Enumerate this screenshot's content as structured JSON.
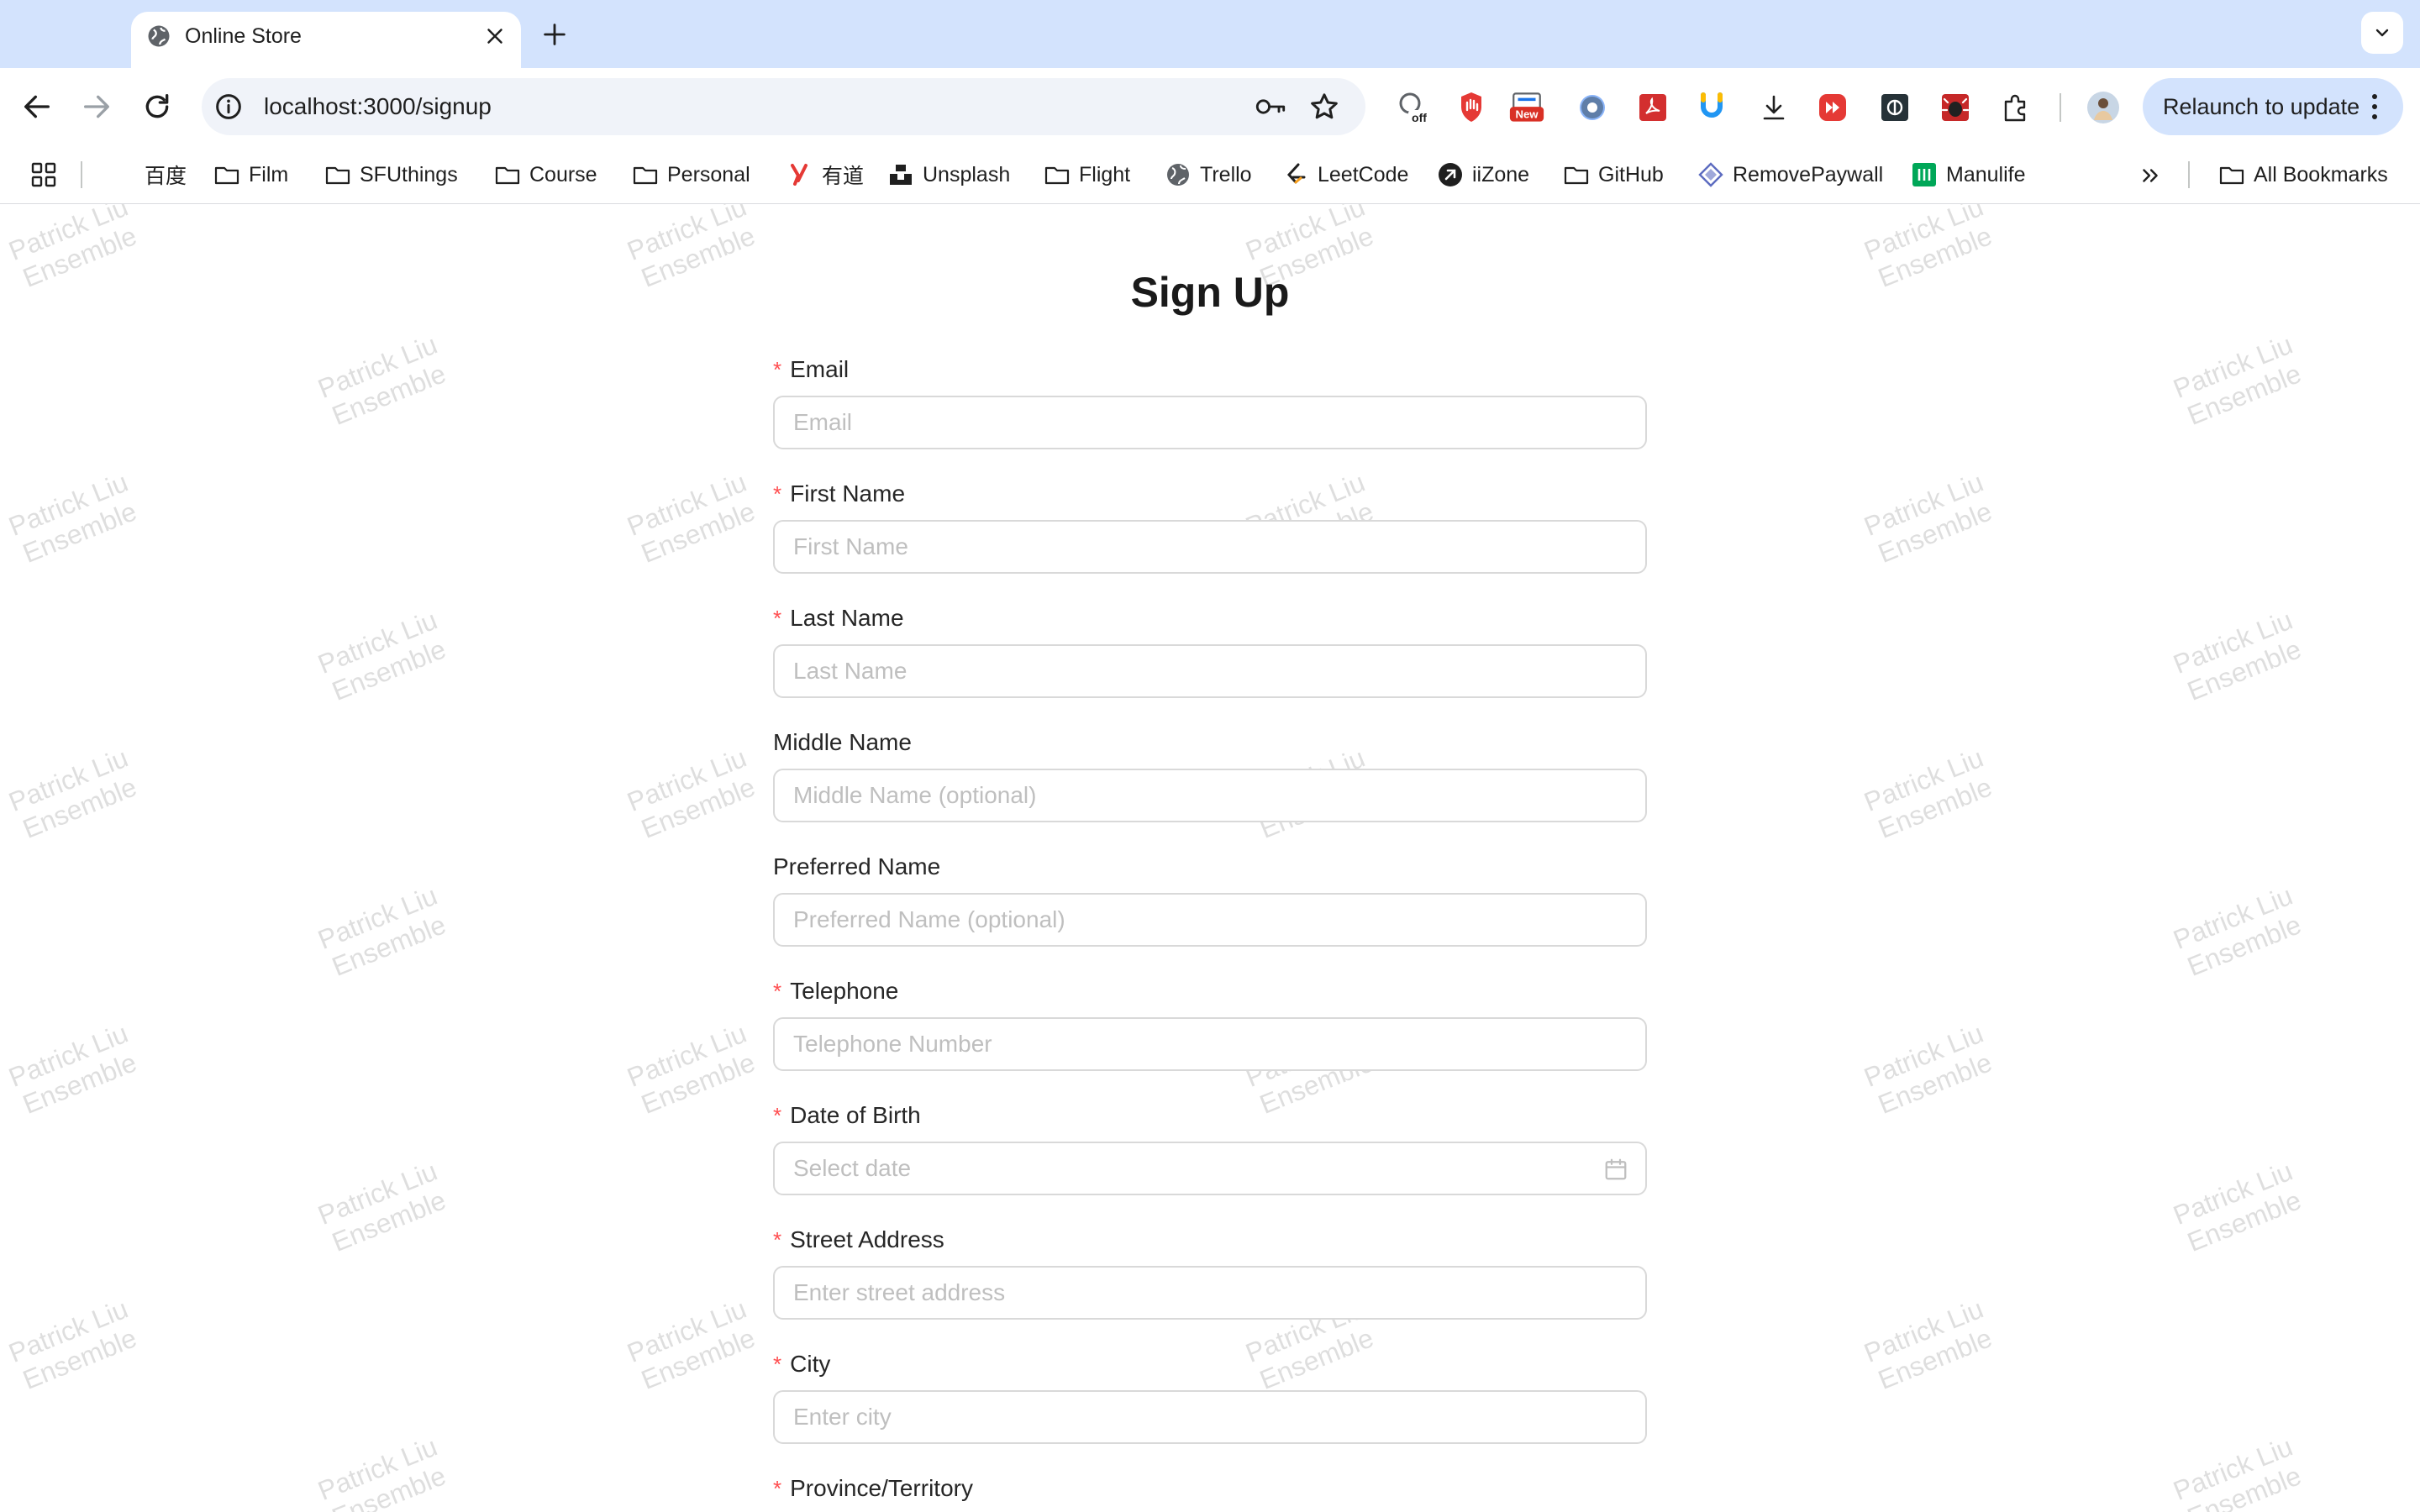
{
  "browser": {
    "tab_title": "Online Store",
    "url": "localhost:3000/signup",
    "relaunch_label": "Relaunch to update",
    "extension_badges": {
      "off": "off",
      "new": "New"
    },
    "bookmarks": [
      {
        "label": "百度",
        "icon": "none"
      },
      {
        "label": "Film",
        "icon": "folder-icon"
      },
      {
        "label": "SFUthings",
        "icon": "folder-icon"
      },
      {
        "label": "Course",
        "icon": "folder-icon"
      },
      {
        "label": "Personal",
        "icon": "folder-icon"
      },
      {
        "label": "有道",
        "icon": "youdao-icon"
      },
      {
        "label": "Unsplash",
        "icon": "unsplash-icon"
      },
      {
        "label": "Flight",
        "icon": "folder-icon"
      },
      {
        "label": "Trello",
        "icon": "globe-icon"
      },
      {
        "label": "LeetCode",
        "icon": "leetcode-icon"
      },
      {
        "label": "iiZone",
        "icon": "iizone-icon"
      },
      {
        "label": "GitHub",
        "icon": "folder-icon"
      },
      {
        "label": "RemovePaywall",
        "icon": "removepaywall-icon"
      },
      {
        "label": "Manulife",
        "icon": "manulife-icon"
      }
    ],
    "all_bookmarks": "All Bookmarks"
  },
  "watermark": {
    "line1": "Patrick Liu",
    "line2": "Ensemble"
  },
  "form": {
    "title": "Sign Up",
    "fields": [
      {
        "label": "Email",
        "required": true,
        "placeholder": "Email"
      },
      {
        "label": "First Name",
        "required": true,
        "placeholder": "First Name"
      },
      {
        "label": "Last Name",
        "required": true,
        "placeholder": "Last Name"
      },
      {
        "label": "Middle Name",
        "required": false,
        "placeholder": "Middle Name (optional)"
      },
      {
        "label": "Preferred Name",
        "required": false,
        "placeholder": "Preferred Name (optional)"
      },
      {
        "label": "Telephone",
        "required": true,
        "placeholder": "Telephone Number"
      },
      {
        "label": "Date of Birth",
        "required": true,
        "placeholder": "Select date"
      },
      {
        "label": "Street Address",
        "required": true,
        "placeholder": "Enter street address"
      },
      {
        "label": "City",
        "required": true,
        "placeholder": "Enter city"
      },
      {
        "label": "Province/Territory",
        "required": true,
        "placeholder": ""
      }
    ],
    "required_marker": "*"
  },
  "colors": {
    "required": "#ff4d4f",
    "tabstrip": "#d3e3fd",
    "relaunch": "#d3e3fd"
  }
}
